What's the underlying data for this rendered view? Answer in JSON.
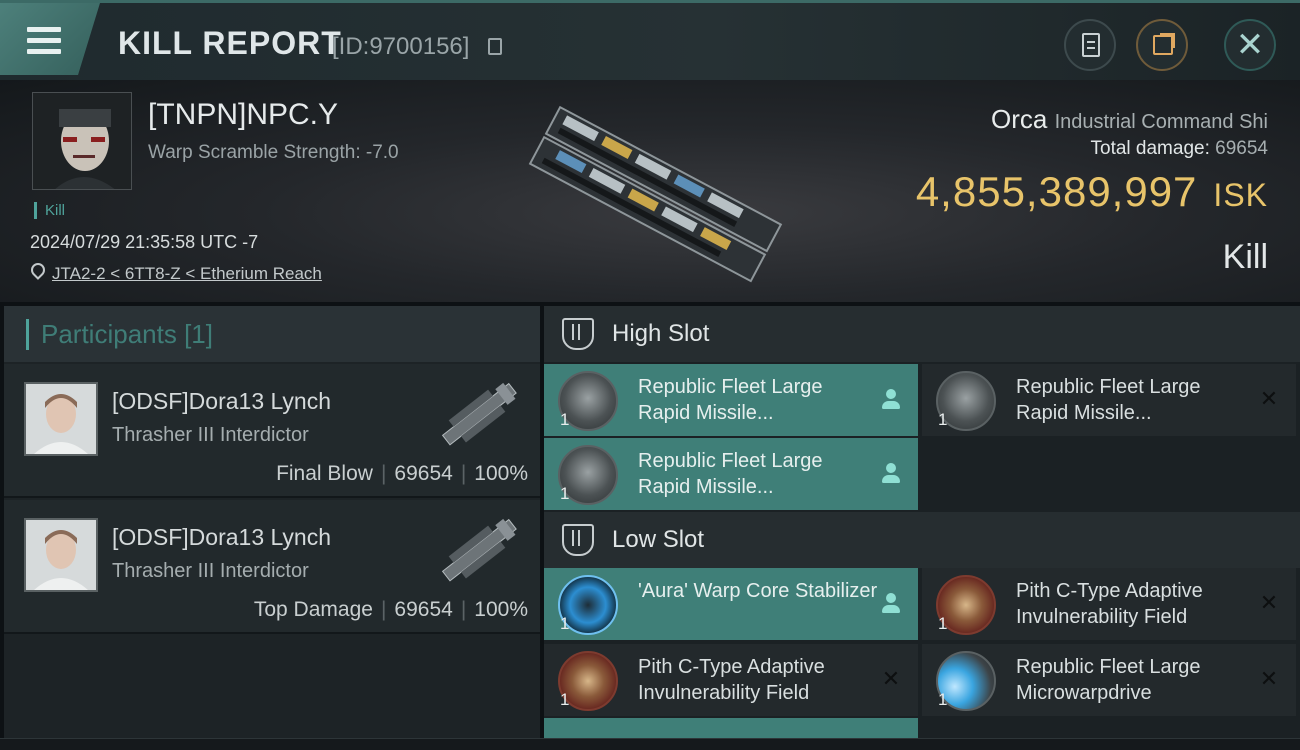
{
  "header": {
    "title": "KILL REPORT",
    "report_id": "[ID:9700156]",
    "icons": [
      "menu-icon",
      "copy-icon",
      "document-icon",
      "share-icon",
      "close-icon"
    ]
  },
  "victim": {
    "name": "[TNPN]NPC.Y",
    "warp_scramble": "Warp Scramble Strength: -7.0",
    "tag": "Kill",
    "datetime": "2024/07/29 21:35:58 UTC -7",
    "location": "JTA2-2 < 6TT8-Z < Etherium Reach"
  },
  "ship": {
    "name": "Orca",
    "class": "Industrial Command Shi",
    "total_damage_label": "Total damage:",
    "total_damage": "69654",
    "isk_value": "4,855,389,997",
    "isk_unit": "ISK",
    "result": "Kill"
  },
  "participants": {
    "title": "Participants",
    "count": "[1]",
    "rows": [
      {
        "name": "[ODSF]Dora13 Lynch",
        "ship": "Thrasher III Interdictor",
        "role": "Final Blow",
        "damage": "69654",
        "percent": "100%"
      },
      {
        "name": "[ODSF]Dora13 Lynch",
        "ship": "Thrasher III Interdictor",
        "role": "Top Damage",
        "damage": "69654",
        "percent": "100%"
      }
    ]
  },
  "slots": {
    "high": {
      "title": "High Slot",
      "modules": [
        {
          "name": "Republic Fleet Large Rapid Missile...",
          "qty": "1",
          "status": "dropped"
        },
        {
          "name": "Republic Fleet Large Rapid Missile...",
          "qty": "1",
          "status": "destroyed"
        },
        {
          "name": "Republic Fleet Large Rapid Missile...",
          "qty": "1",
          "status": "dropped"
        }
      ]
    },
    "low": {
      "title": "Low Slot",
      "modules": [
        {
          "name": "'Aura' Warp Core Stabilizer",
          "qty": "1",
          "status": "dropped"
        },
        {
          "name": "Pith C-Type Adaptive Invulnerability Field",
          "qty": "1",
          "status": "destroyed"
        },
        {
          "name": "Pith C-Type Adaptive Invulnerability Field",
          "qty": "1",
          "status": "destroyed"
        },
        {
          "name": "Republic Fleet Large Microwarpdrive",
          "qty": "1",
          "status": "destroyed"
        }
      ]
    }
  },
  "colors": {
    "accent_teal": "#4fa39b",
    "dropped_bg": "#3f7f78",
    "isk_gold": "#e8c46a"
  }
}
